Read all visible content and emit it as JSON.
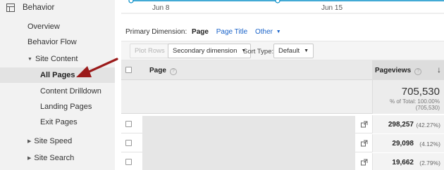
{
  "sidebar": {
    "section_title": "Behavior",
    "items": [
      {
        "label": "Overview"
      },
      {
        "label": "Behavior Flow"
      },
      {
        "label": "Site Content"
      },
      {
        "label": "All Pages"
      },
      {
        "label": "Content Drilldown"
      },
      {
        "label": "Landing Pages"
      },
      {
        "label": "Exit Pages"
      },
      {
        "label": "Site Speed"
      },
      {
        "label": "Site Search"
      }
    ],
    "selected": "All Pages"
  },
  "timeline": {
    "labels": [
      "Jun 8",
      "Jun 15"
    ],
    "line_color": "#058dc7"
  },
  "primary_dimension": {
    "label": "Primary Dimension:",
    "active": "Page",
    "options": [
      "Page Title",
      "Other"
    ]
  },
  "toolbar": {
    "plot_rows": "Plot Rows",
    "secondary_dimension": "Secondary dimension",
    "sort_type_label": "Sort Type:",
    "sort_type_value": "Default"
  },
  "table": {
    "col_page": "Page",
    "col_pageviews": "Pageviews",
    "totals": {
      "value": "705,530",
      "pct_line": "% of Total: 100.00%",
      "total_line": "(705,530)"
    },
    "rows": [
      {
        "pageviews": "298,257",
        "pct": "(42.27%)"
      },
      {
        "pageviews": "29,098",
        "pct": "(4.12%)"
      },
      {
        "pageviews": "19,662",
        "pct": "(2.79%)"
      }
    ]
  },
  "colors": {
    "annotation_arrow": "#9b1b1b",
    "link": "#1a63c9"
  }
}
